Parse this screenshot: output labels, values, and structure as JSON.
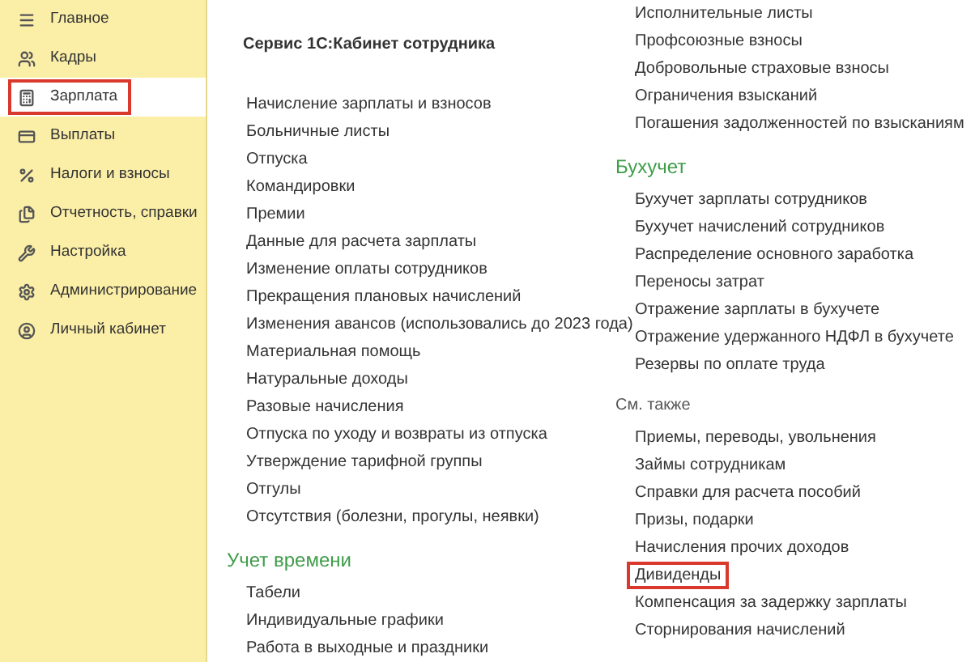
{
  "sidebar": {
    "items": [
      {
        "label": "Главное",
        "selected": false
      },
      {
        "label": "Кадры",
        "selected": false
      },
      {
        "label": "Зарплата",
        "selected": true
      },
      {
        "label": "Выплаты",
        "selected": false
      },
      {
        "label": "Налоги и взносы",
        "selected": false
      },
      {
        "label": "Отчетность, справки",
        "selected": false
      },
      {
        "label": "Настройка",
        "selected": false
      },
      {
        "label": "Администрирование",
        "selected": false
      },
      {
        "label": "Личный кабинет",
        "selected": false
      }
    ]
  },
  "columns": [
    {
      "sections": [
        {
          "kind": "bold",
          "title": "Сервис 1С:Кабинет сотрудника",
          "items": [
            {
              "label": "Начисление зарплаты и взносов"
            },
            {
              "label": "Больничные листы"
            },
            {
              "label": "Отпуска"
            },
            {
              "label": "Командировки"
            },
            {
              "label": "Премии"
            },
            {
              "label": "Данные для расчета зарплаты"
            },
            {
              "label": "Изменение оплаты сотрудников"
            },
            {
              "label": "Прекращения плановых начислений"
            },
            {
              "label": "Изменения авансов (использовались до 2023 года)"
            },
            {
              "label": "Материальная помощь"
            },
            {
              "label": "Натуральные доходы"
            },
            {
              "label": "Разовые начисления"
            },
            {
              "label": "Отпуска по уходу и возвраты из отпуска"
            },
            {
              "label": "Утверждение тарифной группы"
            },
            {
              "label": "Отгулы"
            },
            {
              "label": "Отсутствия (болезни, прогулы, неявки)"
            }
          ]
        },
        {
          "kind": "group",
          "title": "Учет времени",
          "items": [
            {
              "label": "Табели"
            },
            {
              "label": "Индивидуальные графики"
            },
            {
              "label": "Работа в выходные и праздники"
            }
          ]
        }
      ]
    },
    {
      "sections": [
        {
          "kind": "plain",
          "items": [
            {
              "label": "Исполнительные листы"
            },
            {
              "label": "Профсоюзные взносы"
            },
            {
              "label": "Добровольные страховые взносы"
            },
            {
              "label": "Ограничения взысканий"
            },
            {
              "label": "Погашения задолженностей по взысканиям"
            }
          ]
        },
        {
          "kind": "group",
          "title": "Бухучет",
          "items": [
            {
              "label": "Бухучет зарплаты сотрудников"
            },
            {
              "label": "Бухучет начислений сотрудников"
            },
            {
              "label": "Распределение основного заработка"
            },
            {
              "label": "Переносы затрат"
            },
            {
              "label": "Отражение зарплаты в бухучете"
            },
            {
              "label": "Отражение удержанного НДФЛ в бухучете"
            },
            {
              "label": "Резервы по оплате труда"
            }
          ]
        },
        {
          "kind": "see_also",
          "title": "См. также",
          "items": [
            {
              "label": "Приемы, переводы, увольнения",
              "highlighted": false
            },
            {
              "label": "Займы сотрудникам",
              "highlighted": false
            },
            {
              "label": "Справки для расчета пособий",
              "highlighted": false
            },
            {
              "label": "Призы, подарки",
              "highlighted": false
            },
            {
              "label": "Начисления прочих доходов",
              "highlighted": false
            },
            {
              "label": "Дивиденды",
              "highlighted": true
            },
            {
              "label": "Компенсация за задержку зарплаты",
              "highlighted": false
            },
            {
              "label": "Сторнирования начислений",
              "highlighted": false
            }
          ]
        }
      ]
    }
  ]
}
